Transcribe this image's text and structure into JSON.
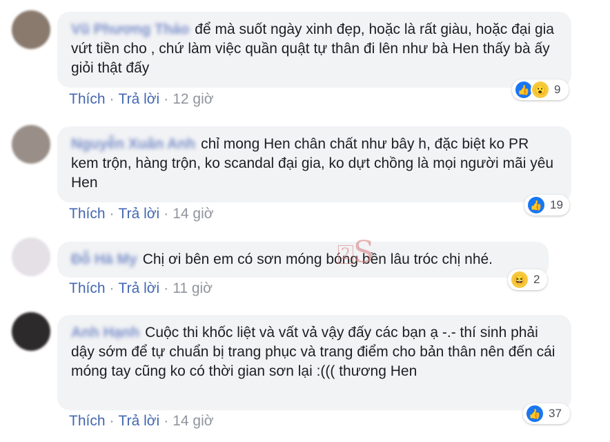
{
  "comments": [
    {
      "author": "Vũ Phương Thảo",
      "text": "để mà suốt ngày xinh đẹp, hoặc là rất giàu, hoặc đại gia vứt tiền cho , chứ làm việc quần quật tự thân đi lên như bà Hen thấy bà ấy giỏi thật đấy",
      "like_label": "Thích",
      "reply_label": "Trả lời",
      "time": "12 giờ",
      "reaction_count": "9",
      "reactions": [
        "like-icon",
        "wow-icon"
      ]
    },
    {
      "author": "Nguyễn Xuân Anh",
      "text": "chỉ mong Hen chân chất như bây h, đặc biệt ko PR kem trộn, hàng trộn, ko scandal đại gia, ko dựt chồng là mọi người mãi yêu Hen",
      "like_label": "Thích",
      "reply_label": "Trả lời",
      "time": "14 giờ",
      "reaction_count": "19",
      "reactions": [
        "like-icon"
      ]
    },
    {
      "author": "Đỗ Hà My",
      "text": "Chị ơi bên em có sơn móng bóng bền lâu tróc chị nhé.",
      "like_label": "Thích",
      "reply_label": "Trả lời",
      "time": "11 giờ",
      "reaction_count": "2",
      "reactions": [
        "haha-icon"
      ]
    },
    {
      "author": "Anh Hạnh",
      "text": "Cuộc thi khốc liệt và vất vả vậy đấy các bạn ạ -.- thí sinh phải dậy sớm để tự chuẩn bị trang phục và trang điểm cho bản thân nên đến cái móng tay cũng ko có thời gian sơn lại :((( thương Hen",
      "like_label": "Thích",
      "reply_label": "Trả lời",
      "time": "14 giờ",
      "reaction_count": "37",
      "reactions": [
        "like-icon"
      ]
    }
  ],
  "watermark": {
    "num": "2",
    "letter": "S"
  },
  "colors": {
    "link": "#4267b2",
    "bubble": "#f2f3f5",
    "meta": "#90949c"
  }
}
